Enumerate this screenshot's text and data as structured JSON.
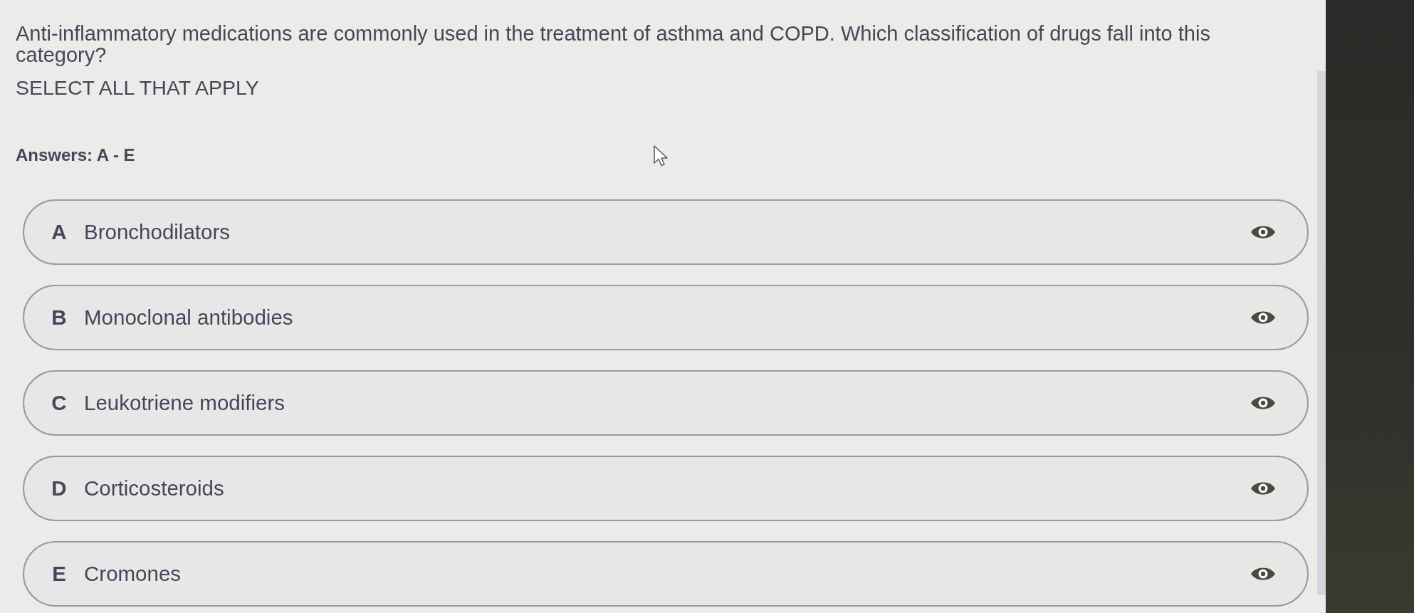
{
  "question": {
    "text": "Anti-inflammatory medications are commonly used in the treatment of asthma and COPD. Which classification of drugs fall into this category?",
    "instruction": "SELECT ALL THAT APPLY"
  },
  "answers_label": "Answers: A - E",
  "options": [
    {
      "letter": "A",
      "text": "Bronchodilators"
    },
    {
      "letter": "B",
      "text": "Monoclonal antibodies"
    },
    {
      "letter": "C",
      "text": "Leukotriene modifiers"
    },
    {
      "letter": "D",
      "text": "Corticosteroids"
    },
    {
      "letter": "E",
      "text": "Cromones"
    }
  ]
}
